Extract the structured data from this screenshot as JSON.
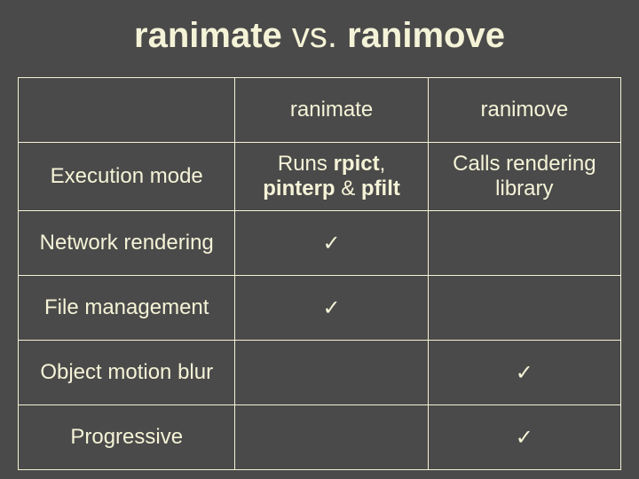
{
  "title": {
    "a": "ranimate",
    "vs": " vs. ",
    "b": "ranimove"
  },
  "headers": {
    "col1": "ranimate",
    "col2": "ranimove"
  },
  "rows": [
    {
      "label": "Execution mode",
      "c1_runs": "Runs ",
      "c1_rpict": "rpict",
      "c1_comma": ", ",
      "c1_pinterp": "pinterp",
      "c1_amp": " & ",
      "c1_pfilt": "pfilt",
      "c2": "Calls rendering library"
    },
    {
      "label": "Network rendering",
      "c1": "✓",
      "c2": ""
    },
    {
      "label": "File management",
      "c1": "✓",
      "c2": ""
    },
    {
      "label": "Object motion blur",
      "c1": "",
      "c2": "✓"
    },
    {
      "label": "Progressive",
      "c1": "",
      "c2": "✓"
    }
  ]
}
